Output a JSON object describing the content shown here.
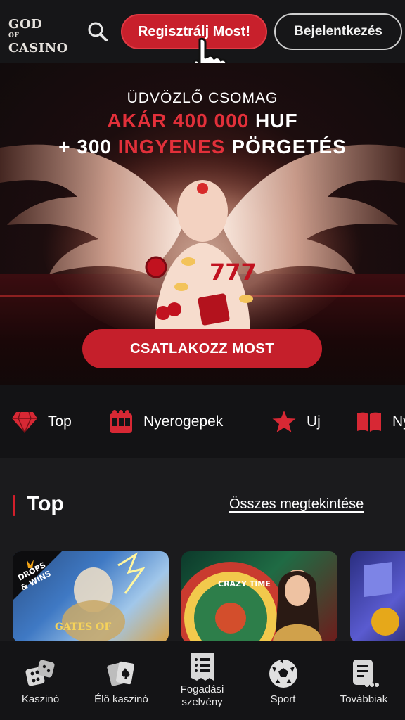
{
  "header": {
    "logo_line1": "GOD",
    "logo_of": "OF",
    "logo_line2": "CASINO",
    "register_label": "Regisztrálj Most!",
    "login_label": "Bejelentkezés"
  },
  "hero": {
    "subtitle": "ÜDVÖZLŐ CSOMAG",
    "line1_red": "AKÁR 400 000",
    "line1_white": "HUF",
    "line2_white": "+ 300",
    "line2_red": "INGYENES",
    "line2_white2": "PÖRGETÉS",
    "cta_label": "CSATLAKOZZ MOST",
    "slot_text": "777"
  },
  "categories": [
    {
      "icon": "diamond-icon",
      "label": "Top"
    },
    {
      "icon": "slot-machine-icon",
      "label": "Nyerogepek"
    },
    {
      "icon": "star-icon",
      "label": "Uj"
    },
    {
      "icon": "book-icon",
      "label": "Ny"
    }
  ],
  "section": {
    "title": "Top",
    "see_all": "Összes megtekintése"
  },
  "games": [
    {
      "badge_line1": "DROPS",
      "badge_line2": "& WINS",
      "name": "GATES OF"
    },
    {
      "name": "CRAZY TIME"
    },
    {
      "name": ""
    }
  ],
  "bottom_nav": [
    {
      "icon": "dice-icon",
      "label": "Kaszinó"
    },
    {
      "icon": "cards-icon",
      "label": "Élő kaszinó"
    },
    {
      "icon": "betslip-icon",
      "label": "Fogadási szelvény"
    },
    {
      "icon": "soccer-ball-icon",
      "label": "Sport"
    },
    {
      "icon": "more-icon",
      "label": "Továbbiak"
    }
  ],
  "colors": {
    "accent_red": "#c8202c",
    "background": "#1b1b1d",
    "bar_bg": "#131315"
  }
}
